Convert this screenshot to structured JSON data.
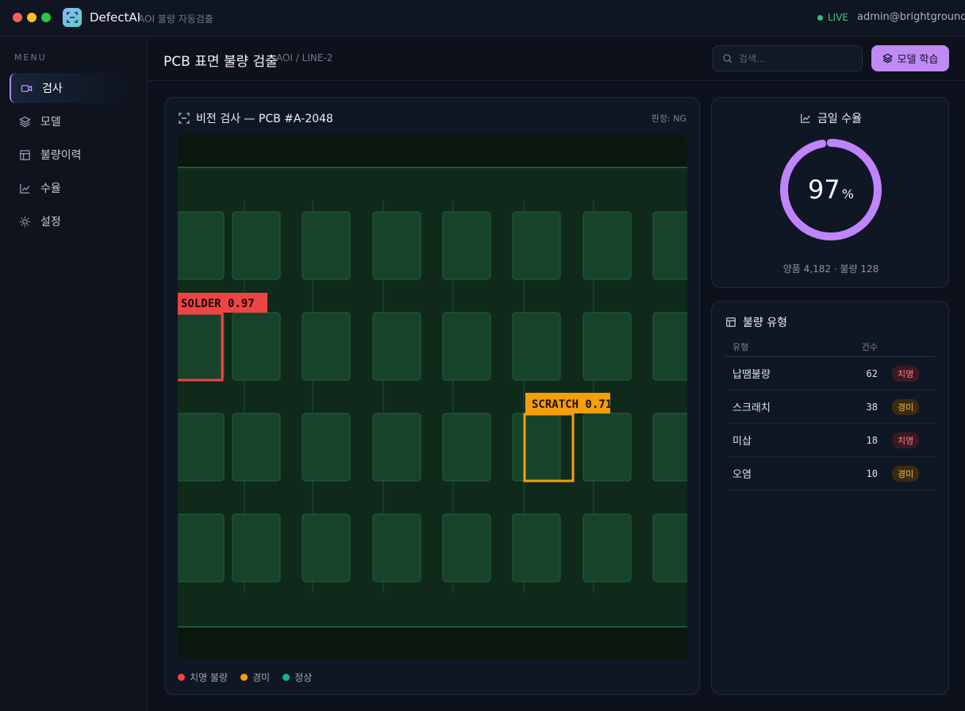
{
  "app": {
    "name": "DefectAI",
    "subtitle": "AOI 불량 자동검출",
    "status": "LIVE",
    "user": "admin@brightground"
  },
  "sidebar": {
    "menu_title": "MENU",
    "items": [
      {
        "label": "검사",
        "icon": "video-camera-icon",
        "active": true
      },
      {
        "label": "모델",
        "icon": "layers-icon"
      },
      {
        "label": "불량이력",
        "icon": "table-icon"
      },
      {
        "label": "수율",
        "icon": "line-chart-icon"
      },
      {
        "label": "설정",
        "icon": "sun-gear-icon"
      }
    ]
  },
  "header": {
    "title": "PCB 표면 불량 검출",
    "breadcrumb": "AOI / LINE-2",
    "search_placeholder": "검색…",
    "train_label": "모델 학습"
  },
  "vision": {
    "title": "비전 검사 — PCB #A-2048",
    "verdict": "판정: NG",
    "detections": [
      {
        "label": "SOLDER 0.97",
        "severity": "critical"
      },
      {
        "label": "SCRATCH 0.71",
        "severity": "minor"
      }
    ],
    "legend": [
      {
        "label": "치명 불량",
        "color": "#ef4444"
      },
      {
        "label": "경미",
        "color": "#f59e0b"
      },
      {
        "label": "정상",
        "color": "#10b981"
      }
    ]
  },
  "yield": {
    "title": "금일 수율",
    "value": "97",
    "unit": "%",
    "percent": 97,
    "footer": "양품 4,182 · 불량 128",
    "accent": "#c084fc"
  },
  "types": {
    "title": "불량 유형",
    "columns": [
      "유형",
      "건수"
    ],
    "rows": [
      {
        "name": "납땜불량",
        "count": "62",
        "severity": "치명",
        "level": "crit"
      },
      {
        "name": "스크래치",
        "count": "38",
        "severity": "경미",
        "level": "minor"
      },
      {
        "name": "미삽",
        "count": "18",
        "severity": "치명",
        "level": "crit"
      },
      {
        "name": "오염",
        "count": "10",
        "severity": "경미",
        "level": "minor"
      }
    ]
  }
}
